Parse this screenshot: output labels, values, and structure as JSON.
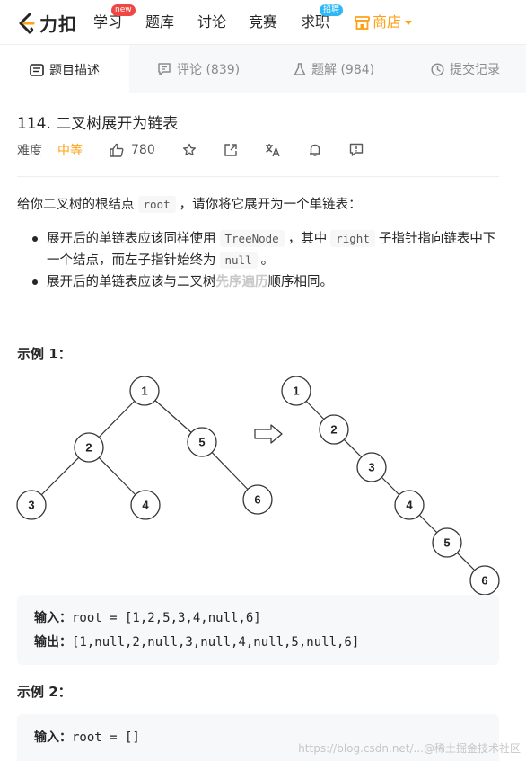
{
  "nav": {
    "logo_text": "力扣",
    "items": [
      "学习",
      "题库",
      "讨论",
      "竞赛",
      "求职"
    ],
    "badge_new": "new",
    "badge_hire": "招聘",
    "store": "商店",
    "accent": "#ffa116"
  },
  "tabs": {
    "description": "题目描述",
    "comments": "评论 (839)",
    "solutions": "题解 (984)",
    "submissions": "提交记录"
  },
  "problem": {
    "title": "114. 二叉树展开为链表",
    "difficulty_label": "难度",
    "difficulty": "中等",
    "likes": "780"
  },
  "description": {
    "intro_before": "给你二叉树的根结点",
    "intro_code": "root",
    "intro_after": "，请你将它展开为一个单链表：",
    "bullet1_a": "展开后的单链表应该同样使用",
    "bullet1_code1": "TreeNode",
    "bullet1_b": "，其中",
    "bullet1_code2": "right",
    "bullet1_c": "子指针指向链表中下一个结点，而左子指针始终为",
    "bullet1_code3": "null",
    "bullet1_d": "。",
    "bullet2_a": "展开后的单链表应该与二叉树",
    "bullet2_hl": "先序遍历",
    "bullet2_b": "顺序相同。"
  },
  "example1": {
    "title": "示例 1：",
    "tree_nodes": [
      "1",
      "2",
      "5",
      "3",
      "4",
      "6"
    ],
    "list_nodes": [
      "1",
      "2",
      "3",
      "4",
      "5",
      "6"
    ],
    "input_label": "输入：",
    "input_value": "root = [1,2,5,3,4,null,6]",
    "output_label": "输出：",
    "output_value": "[1,null,2,null,3,null,4,null,5,null,6]"
  },
  "example2": {
    "title": "示例 2：",
    "input_label": "输入：",
    "input_value": "root = []"
  },
  "watermark": "https://blog.csdn.net/...@稀土掘金技术社区"
}
